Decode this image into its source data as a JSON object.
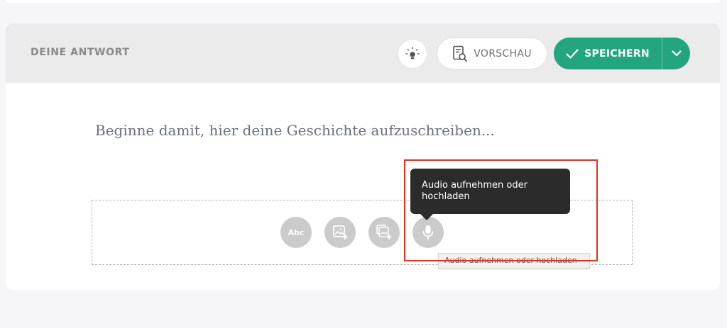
{
  "header": {
    "title": "DEINE ANTWORT",
    "preview_label": "VORSCHAU",
    "save_label": "SPEICHERN"
  },
  "editor": {
    "placeholder": "Beginne damit, hier deine Geschichte aufzuschreiben..."
  },
  "toolbar": {
    "text_tool_label": "Abc",
    "tools": [
      "text-icon",
      "add-image-icon",
      "add-gallery-icon",
      "microphone-icon"
    ]
  },
  "tooltip": {
    "text": "Audio aufnehmen oder hochladen",
    "native_tooltip": "Audio aufnehmen oder hochladen"
  },
  "colors": {
    "accent": "#23a57f",
    "highlight": "#e0311f",
    "tool_gray": "#cbcbcb"
  }
}
